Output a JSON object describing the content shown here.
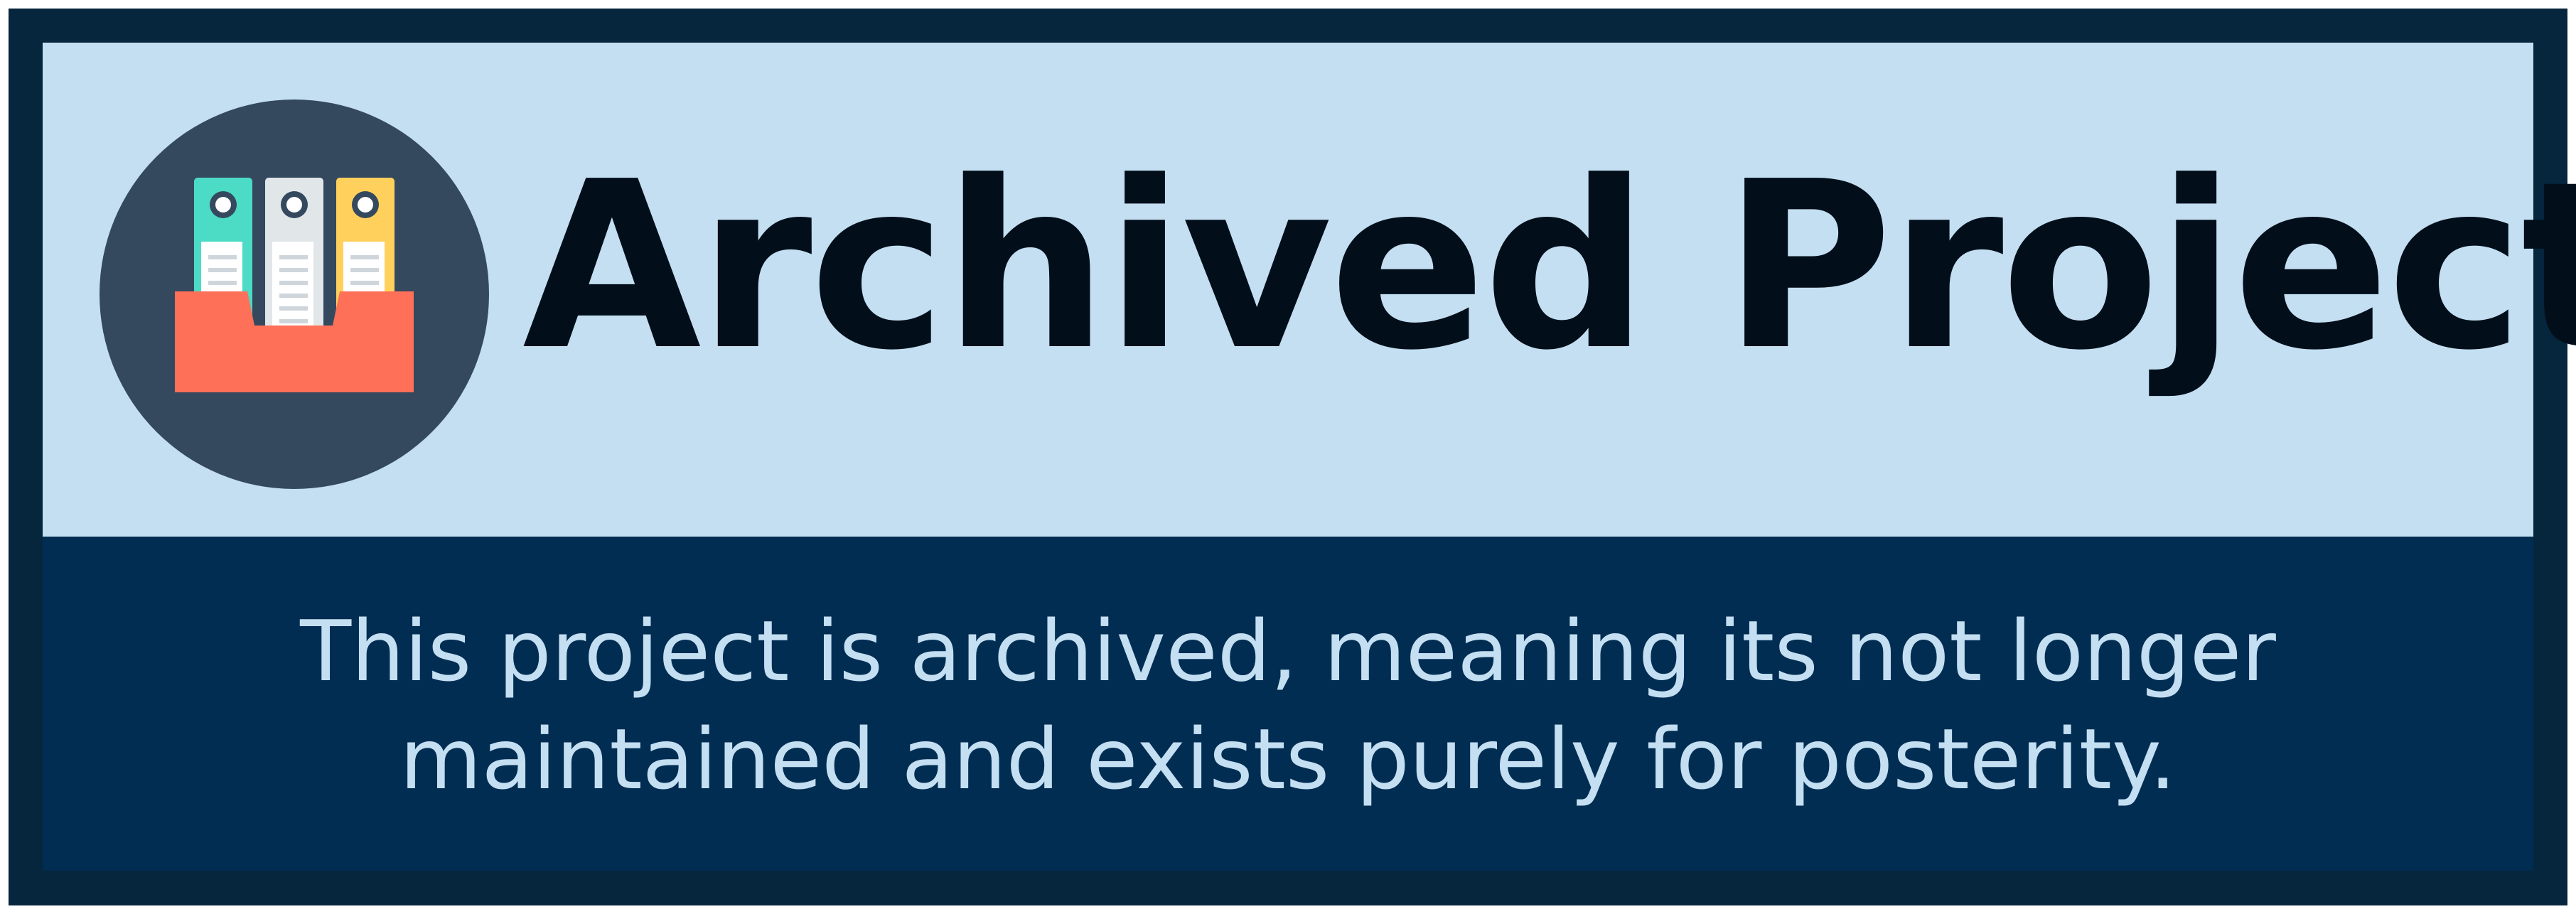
{
  "banner": {
    "title": "Archived Project",
    "description_lines": [
      "This project is archived, meaning its not longer",
      "maintained and exists purely for posterity."
    ],
    "icon": "archive-binders-icon",
    "colors": {
      "frame": "#05263d",
      "header_background": "#c4dff2",
      "body_background": "#012d52",
      "title_text": "#020f1a",
      "description_text": "#c4dff2",
      "icon_circle": "#34495e",
      "box_red": "#ff7058",
      "binder_teal": "#4cdbc4",
      "binder_gray": "#e1e6e9",
      "binder_yellow": "#ffd15c"
    }
  }
}
